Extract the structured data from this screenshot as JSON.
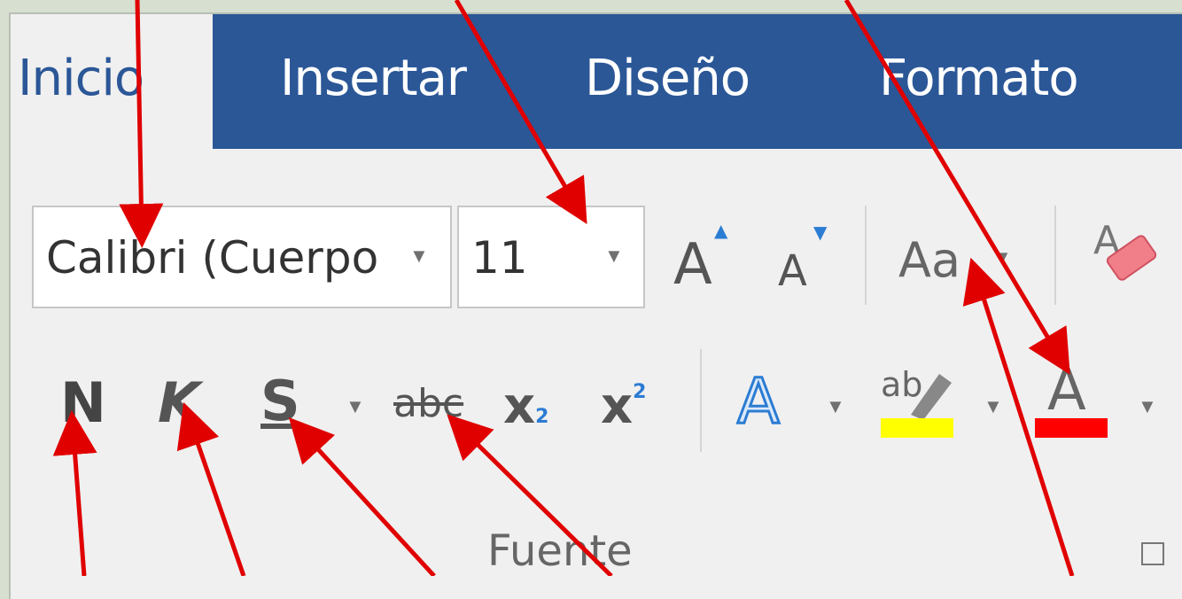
{
  "tabs": {
    "home": "Inicio",
    "insert": "Insertar",
    "design": "Diseño",
    "format": "Formato"
  },
  "font": {
    "name": "Calibri (Cuerpo",
    "size": "11"
  },
  "buttons": {
    "bold": "N",
    "italic": "K",
    "underline": "S",
    "strike": "abc",
    "subscript": "x",
    "subscript_num": "2",
    "superscript": "x",
    "superscript_num": "2",
    "change_case": "Aa",
    "grow": "A",
    "shrink": "A",
    "effects": "A",
    "highlight": "ab",
    "font_color": "A"
  },
  "group": {
    "label": "Fuente"
  },
  "colors": {
    "ribbon_blue": "#2b5797",
    "highlight_yellow": "#ffff00",
    "font_red": "#ff0000",
    "arrow_red": "#e00000"
  }
}
